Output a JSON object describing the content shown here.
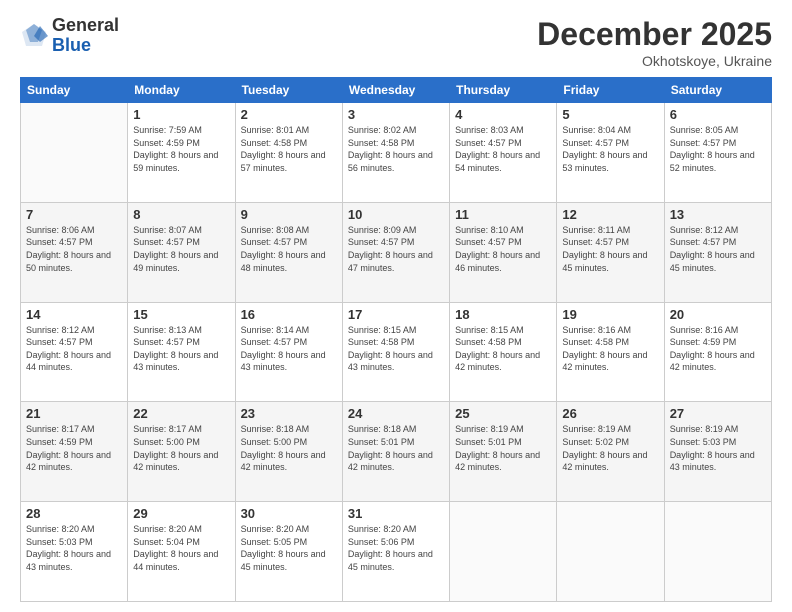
{
  "logo": {
    "general": "General",
    "blue": "Blue"
  },
  "header": {
    "month": "December 2025",
    "location": "Okhotskoye, Ukraine"
  },
  "days_of_week": [
    "Sunday",
    "Monday",
    "Tuesday",
    "Wednesday",
    "Thursday",
    "Friday",
    "Saturday"
  ],
  "weeks": [
    [
      {
        "day": "",
        "sunrise": "",
        "sunset": "",
        "daylight": ""
      },
      {
        "day": "1",
        "sunrise": "Sunrise: 7:59 AM",
        "sunset": "Sunset: 4:59 PM",
        "daylight": "Daylight: 8 hours and 59 minutes."
      },
      {
        "day": "2",
        "sunrise": "Sunrise: 8:01 AM",
        "sunset": "Sunset: 4:58 PM",
        "daylight": "Daylight: 8 hours and 57 minutes."
      },
      {
        "day": "3",
        "sunrise": "Sunrise: 8:02 AM",
        "sunset": "Sunset: 4:58 PM",
        "daylight": "Daylight: 8 hours and 56 minutes."
      },
      {
        "day": "4",
        "sunrise": "Sunrise: 8:03 AM",
        "sunset": "Sunset: 4:57 PM",
        "daylight": "Daylight: 8 hours and 54 minutes."
      },
      {
        "day": "5",
        "sunrise": "Sunrise: 8:04 AM",
        "sunset": "Sunset: 4:57 PM",
        "daylight": "Daylight: 8 hours and 53 minutes."
      },
      {
        "day": "6",
        "sunrise": "Sunrise: 8:05 AM",
        "sunset": "Sunset: 4:57 PM",
        "daylight": "Daylight: 8 hours and 52 minutes."
      }
    ],
    [
      {
        "day": "7",
        "sunrise": "Sunrise: 8:06 AM",
        "sunset": "Sunset: 4:57 PM",
        "daylight": "Daylight: 8 hours and 50 minutes."
      },
      {
        "day": "8",
        "sunrise": "Sunrise: 8:07 AM",
        "sunset": "Sunset: 4:57 PM",
        "daylight": "Daylight: 8 hours and 49 minutes."
      },
      {
        "day": "9",
        "sunrise": "Sunrise: 8:08 AM",
        "sunset": "Sunset: 4:57 PM",
        "daylight": "Daylight: 8 hours and 48 minutes."
      },
      {
        "day": "10",
        "sunrise": "Sunrise: 8:09 AM",
        "sunset": "Sunset: 4:57 PM",
        "daylight": "Daylight: 8 hours and 47 minutes."
      },
      {
        "day": "11",
        "sunrise": "Sunrise: 8:10 AM",
        "sunset": "Sunset: 4:57 PM",
        "daylight": "Daylight: 8 hours and 46 minutes."
      },
      {
        "day": "12",
        "sunrise": "Sunrise: 8:11 AM",
        "sunset": "Sunset: 4:57 PM",
        "daylight": "Daylight: 8 hours and 45 minutes."
      },
      {
        "day": "13",
        "sunrise": "Sunrise: 8:12 AM",
        "sunset": "Sunset: 4:57 PM",
        "daylight": "Daylight: 8 hours and 45 minutes."
      }
    ],
    [
      {
        "day": "14",
        "sunrise": "Sunrise: 8:12 AM",
        "sunset": "Sunset: 4:57 PM",
        "daylight": "Daylight: 8 hours and 44 minutes."
      },
      {
        "day": "15",
        "sunrise": "Sunrise: 8:13 AM",
        "sunset": "Sunset: 4:57 PM",
        "daylight": "Daylight: 8 hours and 43 minutes."
      },
      {
        "day": "16",
        "sunrise": "Sunrise: 8:14 AM",
        "sunset": "Sunset: 4:57 PM",
        "daylight": "Daylight: 8 hours and 43 minutes."
      },
      {
        "day": "17",
        "sunrise": "Sunrise: 8:15 AM",
        "sunset": "Sunset: 4:58 PM",
        "daylight": "Daylight: 8 hours and 43 minutes."
      },
      {
        "day": "18",
        "sunrise": "Sunrise: 8:15 AM",
        "sunset": "Sunset: 4:58 PM",
        "daylight": "Daylight: 8 hours and 42 minutes."
      },
      {
        "day": "19",
        "sunrise": "Sunrise: 8:16 AM",
        "sunset": "Sunset: 4:58 PM",
        "daylight": "Daylight: 8 hours and 42 minutes."
      },
      {
        "day": "20",
        "sunrise": "Sunrise: 8:16 AM",
        "sunset": "Sunset: 4:59 PM",
        "daylight": "Daylight: 8 hours and 42 minutes."
      }
    ],
    [
      {
        "day": "21",
        "sunrise": "Sunrise: 8:17 AM",
        "sunset": "Sunset: 4:59 PM",
        "daylight": "Daylight: 8 hours and 42 minutes."
      },
      {
        "day": "22",
        "sunrise": "Sunrise: 8:17 AM",
        "sunset": "Sunset: 5:00 PM",
        "daylight": "Daylight: 8 hours and 42 minutes."
      },
      {
        "day": "23",
        "sunrise": "Sunrise: 8:18 AM",
        "sunset": "Sunset: 5:00 PM",
        "daylight": "Daylight: 8 hours and 42 minutes."
      },
      {
        "day": "24",
        "sunrise": "Sunrise: 8:18 AM",
        "sunset": "Sunset: 5:01 PM",
        "daylight": "Daylight: 8 hours and 42 minutes."
      },
      {
        "day": "25",
        "sunrise": "Sunrise: 8:19 AM",
        "sunset": "Sunset: 5:01 PM",
        "daylight": "Daylight: 8 hours and 42 minutes."
      },
      {
        "day": "26",
        "sunrise": "Sunrise: 8:19 AM",
        "sunset": "Sunset: 5:02 PM",
        "daylight": "Daylight: 8 hours and 42 minutes."
      },
      {
        "day": "27",
        "sunrise": "Sunrise: 8:19 AM",
        "sunset": "Sunset: 5:03 PM",
        "daylight": "Daylight: 8 hours and 43 minutes."
      }
    ],
    [
      {
        "day": "28",
        "sunrise": "Sunrise: 8:20 AM",
        "sunset": "Sunset: 5:03 PM",
        "daylight": "Daylight: 8 hours and 43 minutes."
      },
      {
        "day": "29",
        "sunrise": "Sunrise: 8:20 AM",
        "sunset": "Sunset: 5:04 PM",
        "daylight": "Daylight: 8 hours and 44 minutes."
      },
      {
        "day": "30",
        "sunrise": "Sunrise: 8:20 AM",
        "sunset": "Sunset: 5:05 PM",
        "daylight": "Daylight: 8 hours and 45 minutes."
      },
      {
        "day": "31",
        "sunrise": "Sunrise: 8:20 AM",
        "sunset": "Sunset: 5:06 PM",
        "daylight": "Daylight: 8 hours and 45 minutes."
      },
      {
        "day": "",
        "sunrise": "",
        "sunset": "",
        "daylight": ""
      },
      {
        "day": "",
        "sunrise": "",
        "sunset": "",
        "daylight": ""
      },
      {
        "day": "",
        "sunrise": "",
        "sunset": "",
        "daylight": ""
      }
    ]
  ]
}
